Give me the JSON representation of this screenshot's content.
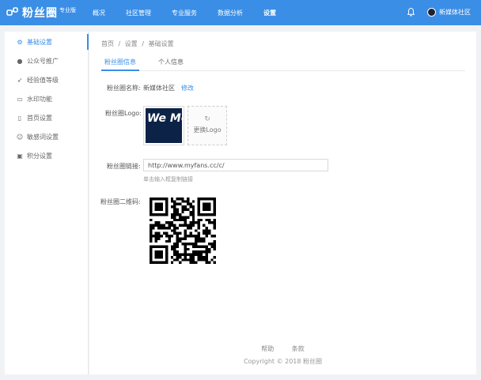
{
  "brand": {
    "name": "粉丝圈",
    "edition": "专业版"
  },
  "topnav": {
    "items": [
      {
        "label": "概况"
      },
      {
        "label": "社区管理"
      },
      {
        "label": "专业服务"
      },
      {
        "label": "数据分析"
      },
      {
        "label": "设置"
      }
    ],
    "active": "设置"
  },
  "user": {
    "name": "新媒体社区"
  },
  "sidebar": {
    "items": [
      {
        "label": "基础设置",
        "icon": "gear-icon",
        "glyph": "⚙"
      },
      {
        "label": "公众号推广",
        "icon": "wechat-icon",
        "glyph": "●"
      },
      {
        "label": "经验值等级",
        "icon": "rocket-icon",
        "glyph": "➶"
      },
      {
        "label": "水印功能",
        "icon": "watermark-icon",
        "glyph": "▭"
      },
      {
        "label": "首页设置",
        "icon": "phone-icon",
        "glyph": "▯"
      },
      {
        "label": "敏感词设置",
        "icon": "smile-icon",
        "glyph": "☺"
      },
      {
        "label": "积分设置",
        "icon": "points-icon",
        "glyph": "▣"
      }
    ],
    "active": "基础设置"
  },
  "breadcrumb": {
    "home": "首页",
    "sep": "/",
    "settings": "设置",
    "current": "基础设置"
  },
  "tabs": [
    {
      "label": "粉丝圈信息"
    },
    {
      "label": "个人信息"
    }
  ],
  "form": {
    "name_label": "粉丝圈名称:",
    "name_value": "新媒体社区",
    "name_edit": "修改",
    "logo_label": "粉丝圈Logo:",
    "logo_image_text": "We Medi",
    "logo_upload_label": "更换Logo",
    "url_label": "粉丝圈链接:",
    "url_value": "http://www.myfans.cc/c/",
    "url_hint": "单击输入框复制链接",
    "qr_label": "粉丝圈二维码:"
  },
  "footer": {
    "links": [
      "帮助",
      "条款"
    ],
    "copyright": "Copyright © 2018 粉丝圈"
  },
  "colors": {
    "primary": "#3a8ee6",
    "topbar": "#3a8ee6",
    "background": "#f0f2f5"
  }
}
